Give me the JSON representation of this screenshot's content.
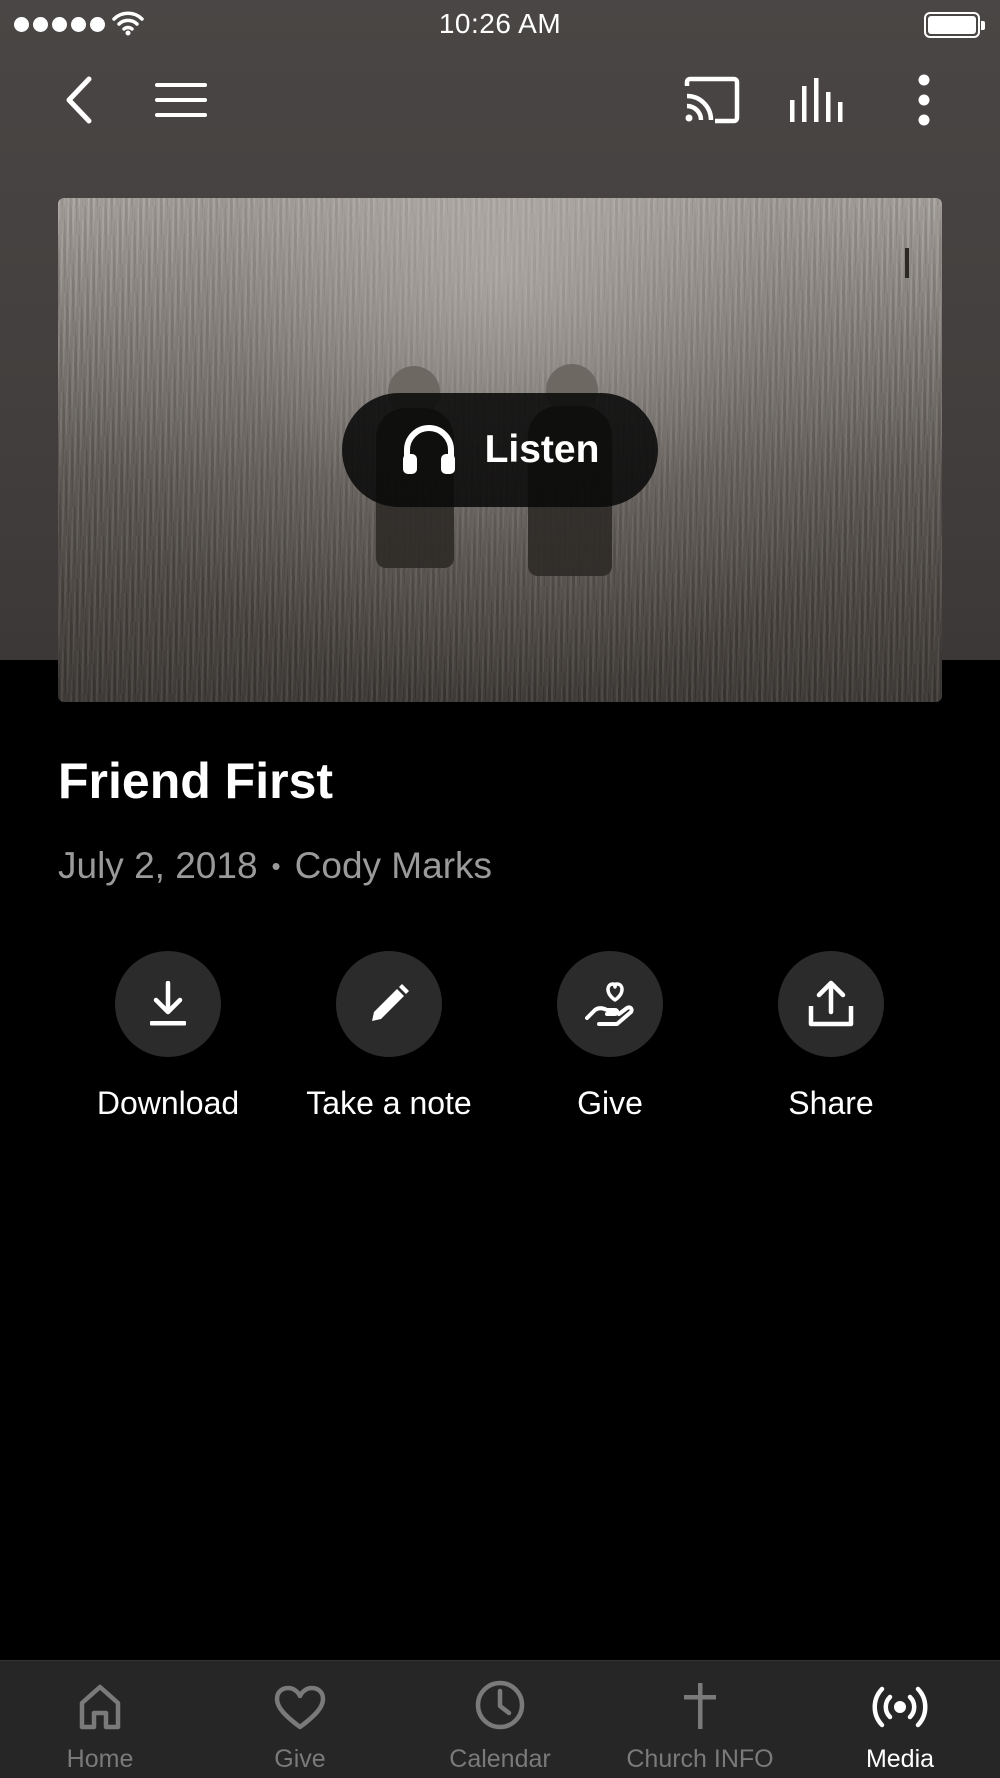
{
  "status_bar": {
    "time": "10:26 AM"
  },
  "hero": {
    "listen_label": "Listen"
  },
  "sermon": {
    "title": "Friend First",
    "date": "July 2, 2018",
    "separator": "•",
    "speaker": "Cody Marks"
  },
  "actions": [
    {
      "label": "Download",
      "icon": "download-icon"
    },
    {
      "label": "Take a note",
      "icon": "pencil-icon"
    },
    {
      "label": "Give",
      "icon": "heart-hand-icon"
    },
    {
      "label": "Share",
      "icon": "share-icon"
    }
  ],
  "tabs": [
    {
      "label": "Home",
      "icon": "home-icon"
    },
    {
      "label": "Give",
      "icon": "heart-icon"
    },
    {
      "label": "Calendar",
      "icon": "clock-icon"
    },
    {
      "label": "Church INFO",
      "icon": "cross-icon"
    },
    {
      "label": "Media",
      "icon": "broadcast-icon",
      "active": true
    }
  ],
  "colors": {
    "background": "#000000",
    "header": "#4a4645",
    "tab_bar": "#262626",
    "inactive": "#7a7a7a"
  }
}
